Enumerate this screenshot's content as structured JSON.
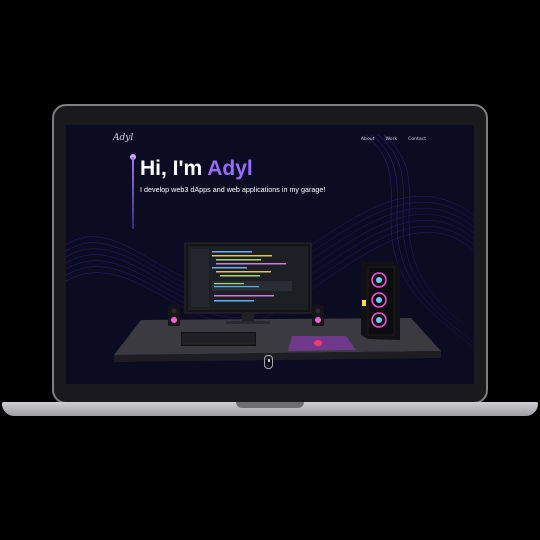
{
  "header": {
    "logo_text": "Adyl",
    "nav": [
      "About",
      "Work",
      "Contact"
    ]
  },
  "hero": {
    "greeting": "Hi, I'm ",
    "name": "Adyl",
    "subtitle": "I develop web3 dApps and web applications in my garage!"
  },
  "colors": {
    "accent": "#9a6bff",
    "background": "#0b0b22",
    "rgb_fan": "#ff4fd8"
  },
  "icons": [
    "mouse-scroll-icon"
  ]
}
